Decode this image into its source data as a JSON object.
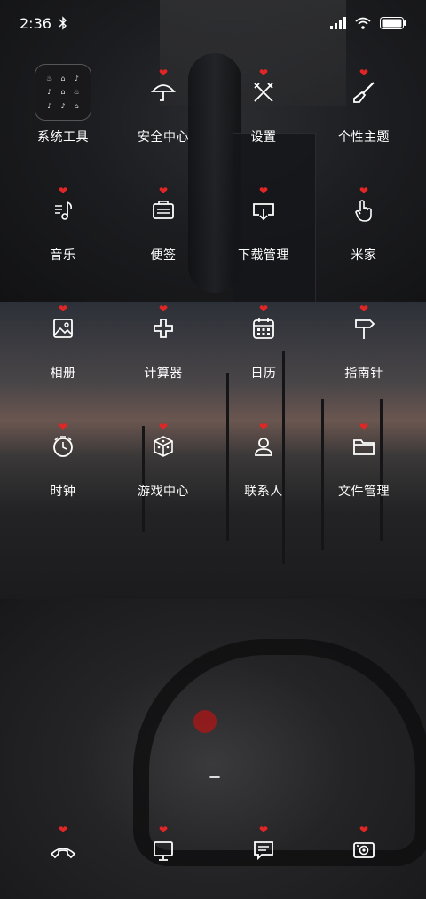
{
  "status": {
    "time": "2:36",
    "icons": [
      "bluetooth-icon",
      "signal-icon",
      "wifi-icon",
      "battery-icon"
    ]
  },
  "apps": [
    {
      "label": "系统工具",
      "icon": "folder-icon",
      "badge": ""
    },
    {
      "label": "安全中心",
      "icon": "umbrella-icon",
      "badge": "❤"
    },
    {
      "label": "设置",
      "icon": "tools-icon",
      "badge": "❤"
    },
    {
      "label": "个性主题",
      "icon": "brush-icon",
      "badge": "❤"
    },
    {
      "label": "音乐",
      "icon": "music-icon",
      "badge": "❤"
    },
    {
      "label": "便签",
      "icon": "notes-icon",
      "badge": "❤"
    },
    {
      "label": "下载管理",
      "icon": "download-icon",
      "badge": "❤"
    },
    {
      "label": "米家",
      "icon": "hand-icon",
      "badge": "❤"
    },
    {
      "label": "相册",
      "icon": "gallery-icon",
      "badge": "❤"
    },
    {
      "label": "计算器",
      "icon": "calculator-icon",
      "badge": "❤"
    },
    {
      "label": "日历",
      "icon": "calendar-icon",
      "badge": "❤"
    },
    {
      "label": "指南针",
      "icon": "signpost-icon",
      "badge": "❤"
    },
    {
      "label": "时钟",
      "icon": "clock-icon",
      "badge": "❤"
    },
    {
      "label": "游戏中心",
      "icon": "dice-icon",
      "badge": "❤"
    },
    {
      "label": "联系人",
      "icon": "contact-icon",
      "badge": "❤"
    },
    {
      "label": "文件管理",
      "icon": "file-folder-icon",
      "badge": "❤"
    }
  ],
  "folder_contents": [
    "♨",
    "⌂",
    "♪",
    "♪",
    "⌂",
    "♨",
    "♪",
    "♪",
    "⌂"
  ],
  "dock": [
    {
      "icon": "phone-icon",
      "badge": "❤"
    },
    {
      "icon": "browser-icon",
      "badge": "❤"
    },
    {
      "icon": "message-icon",
      "badge": "❤"
    },
    {
      "icon": "camera-icon",
      "badge": "❤"
    }
  ],
  "colors": {
    "badge": "#e22525",
    "text": "#ffffff"
  }
}
